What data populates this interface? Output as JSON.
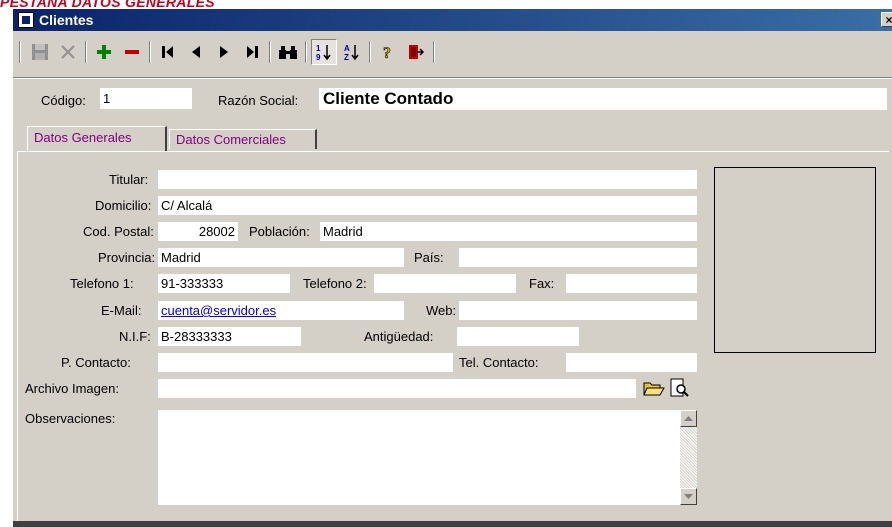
{
  "caption": "PESTAÑA DATOS GENERALES",
  "window": {
    "title": "Clientes",
    "close_glyph": "×"
  },
  "toolbar": {
    "buttons": [
      {
        "name": "save-icon"
      },
      {
        "name": "cancel-icon"
      },
      {
        "name": "add-icon"
      },
      {
        "name": "delete-icon"
      },
      {
        "name": "first-record-icon"
      },
      {
        "name": "previous-record-icon"
      },
      {
        "name": "next-record-icon"
      },
      {
        "name": "last-record-icon"
      },
      {
        "name": "find-binoculars-icon"
      },
      {
        "name": "sort-numeric-icon"
      },
      {
        "name": "sort-alpha-icon"
      },
      {
        "name": "help-icon"
      },
      {
        "name": "exit-icon"
      }
    ]
  },
  "header": {
    "codigo_label": "Código:",
    "codigo_value": "1",
    "razon_label": "Razón Social:",
    "razon_value": "Cliente Contado"
  },
  "tabs": [
    {
      "label": "Datos Generales",
      "active": true
    },
    {
      "label": "Datos Comerciales",
      "active": false
    }
  ],
  "form": {
    "titular": {
      "label": "Titular:",
      "value": ""
    },
    "domicilio": {
      "label": "Domicilio:",
      "value": "C/ Alcalá"
    },
    "cod_postal": {
      "label": "Cod. Postal:",
      "value": "28002"
    },
    "poblacion": {
      "label": "Población:",
      "value": "Madrid"
    },
    "provincia": {
      "label": "Provincia:",
      "value": "Madrid"
    },
    "pais": {
      "label": "País:",
      "value": ""
    },
    "telefono1": {
      "label": "Telefono 1:",
      "value": "91-333333"
    },
    "telefono2": {
      "label": "Telefono 2:",
      "value": ""
    },
    "fax": {
      "label": "Fax:",
      "value": ""
    },
    "email": {
      "label": "E-Mail:",
      "value": "cuenta@servidor.es"
    },
    "web": {
      "label": "Web:",
      "value": ""
    },
    "nif": {
      "label": "N.I.F:",
      "value": "B-28333333"
    },
    "antiguedad": {
      "label": "Antigüedad:",
      "value": ""
    },
    "p_contacto": {
      "label": "P. Contacto:",
      "value": ""
    },
    "tel_contacto": {
      "label": "Tel. Contacto:",
      "value": ""
    },
    "archivo_imagen": {
      "label": "Archivo Imagen:",
      "value": ""
    },
    "observaciones": {
      "label": "Observaciones:",
      "value": ""
    }
  },
  "colors": {
    "title_bar": "#0a246a",
    "window_bg": "#d4d0c8",
    "caption": "#c4001e",
    "tab_text": "#800080"
  }
}
